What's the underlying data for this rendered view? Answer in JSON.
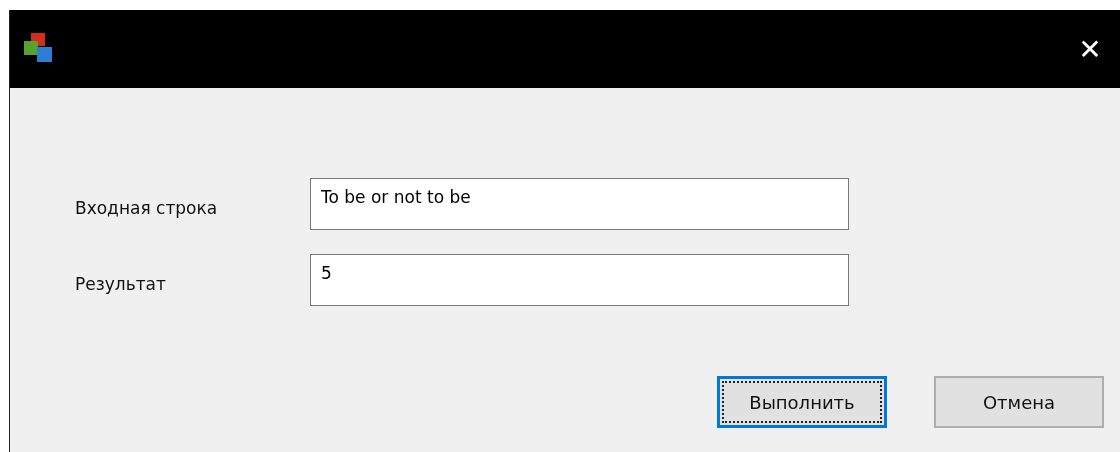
{
  "window": {
    "close": "✕"
  },
  "fields": [
    {
      "label": "Входная строка",
      "value": "To be or not to be"
    },
    {
      "label": "Результат",
      "value": "5"
    }
  ],
  "buttons": [
    {
      "label": "Выполнить",
      "focused": true
    },
    {
      "label": "Отмена",
      "focused": false
    }
  ]
}
